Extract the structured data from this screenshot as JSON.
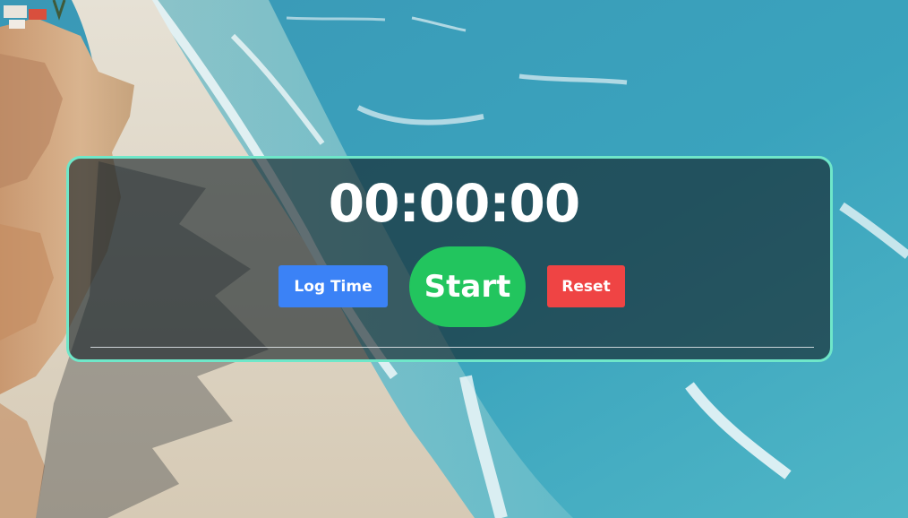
{
  "timer": {
    "display": "00:00:00"
  },
  "controls": {
    "log_time_label": "Log Time",
    "start_label": "Start",
    "reset_label": "Reset"
  },
  "colors": {
    "panel_border": "#6fe7c9",
    "log_time_button": "#3b82f6",
    "start_button": "#22c55e",
    "reset_button": "#ef4444",
    "text": "#ffffff"
  }
}
